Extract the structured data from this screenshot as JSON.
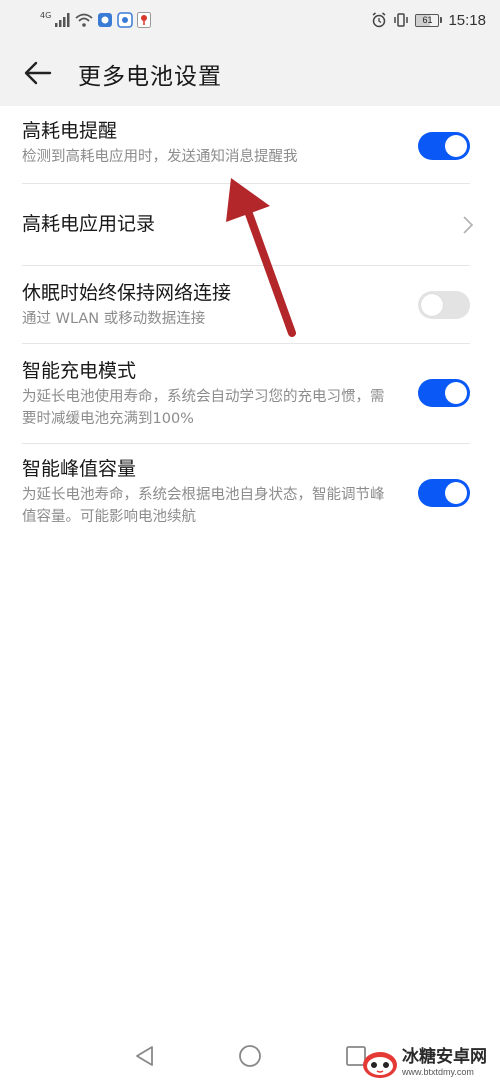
{
  "status_bar": {
    "network_type": "4G",
    "time": "15:18",
    "battery_level": 61,
    "battery_text": "61",
    "left_icons": [
      "signal-icon",
      "wifi-icon",
      "app-notification-icon",
      "app-notification-icon",
      "location-pin-icon"
    ],
    "right_icons": [
      "alarm-icon",
      "vibrate-icon"
    ]
  },
  "app_bar": {
    "title": "更多电池设置",
    "back_icon": "arrow-left-icon"
  },
  "settings": [
    {
      "id": "high-drain-reminder",
      "title": "高耗电提醒",
      "subtitle": "检测到高耗电应用时，发送通知消息提醒我",
      "control": "toggle",
      "state": true
    },
    {
      "id": "high-drain-records",
      "title": "高耗电应用记录",
      "control": "chevron"
    },
    {
      "id": "keep-network-during-sleep",
      "title": "休眠时始终保持网络连接",
      "subtitle": "通过 WLAN 或移动数据连接",
      "control": "toggle",
      "state": false
    },
    {
      "id": "smart-charging-mode",
      "title": "智能充电模式",
      "subtitle": "为延长电池使用寿命，系统会自动学习您的充电习惯，需要时减缓电池充满到100%",
      "control": "toggle",
      "state": true
    },
    {
      "id": "smart-peak-capacity",
      "title": "智能峰值容量",
      "subtitle": "为延长电池寿命，系统会根据电池自身状态，智能调节峰值容量。可能影响电池续航",
      "control": "toggle",
      "state": true
    }
  ],
  "annotation": {
    "color": "#b3262a"
  },
  "nav_bar": {
    "icons": [
      "back-triangle-icon",
      "home-circle-icon",
      "recents-square-icon"
    ]
  },
  "watermark": {
    "name": "冰糖安卓网",
    "url": "www.btxtdmy.com"
  },
  "colors": {
    "accent": "#0a59f7",
    "toggle_off": "#e3e3e3",
    "header_bg": "#f2f2f2",
    "subtitle": "#8c8c8c"
  }
}
